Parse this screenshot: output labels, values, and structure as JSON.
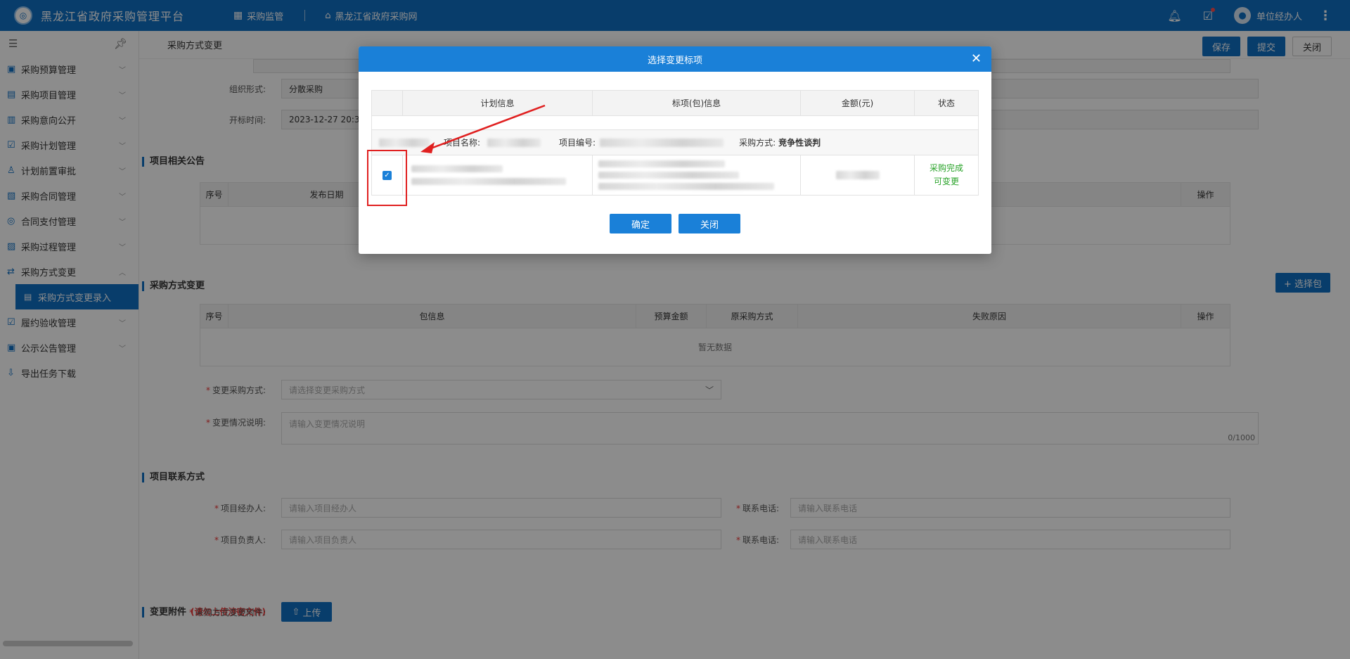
{
  "app": {
    "title": "黑龙江省政府采购管理平台",
    "logo_text": "◎",
    "nav": [
      "采购监管",
      "黑龙江省政府采购网"
    ],
    "user": "单位经办人"
  },
  "sidebar": {
    "items": [
      {
        "label": "采购预算管理"
      },
      {
        "label": "采购项目管理"
      },
      {
        "label": "采购意向公开"
      },
      {
        "label": "采购计划管理"
      },
      {
        "label": "计划前置审批"
      },
      {
        "label": "采购合同管理"
      },
      {
        "label": "合同支付管理"
      },
      {
        "label": "采购过程管理"
      },
      {
        "label": "采购方式变更"
      },
      {
        "label": "履约验收管理"
      },
      {
        "label": "公示公告管理"
      },
      {
        "label": "导出任务下载"
      }
    ],
    "active_sub": "采购方式变更录入"
  },
  "page": {
    "title": "采购方式变更",
    "buttons": {
      "save": "保存",
      "submit": "提交",
      "close": "关闭"
    },
    "org_form_label": "组织形式:",
    "org_form_value": "分散采购",
    "open_time_label": "开标时间:",
    "open_time_value": "2023-12-27 20:31:39",
    "announce_section": "项目相关公告",
    "announce_cols": [
      "序号",
      "发布日期",
      "操作"
    ],
    "change_section": "采购方式变更",
    "select_pkg_btn": "+ 选择包",
    "change_cols": [
      "序号",
      "包信息",
      "预算金额",
      "原采购方式",
      "失败原因",
      "操作"
    ],
    "no_data": "暂无数据",
    "change_method_label": "变更采购方式:",
    "change_method_placeholder": "请选择变更采购方式",
    "change_desc_label": "变更情况说明:",
    "change_desc_placeholder": "请输入变更情况说明",
    "char_count": "0/1000",
    "contact_section": "项目联系方式",
    "handler_label": "项目经办人:",
    "handler_placeholder": "请输入项目经办人",
    "phone_label": "联系电话:",
    "phone_placeholder": "请输入联系电话",
    "leader_label": "项目负责人:",
    "leader_placeholder": "请输入项目负责人",
    "attach_section": "变更附件",
    "attach_warn": "(请勿上传涉密文件)",
    "attach_label": "采购方式变更附件:",
    "upload_btn": "上传"
  },
  "modal": {
    "title": "选择变更标项",
    "cols": [
      "计划信息",
      "标项(包)信息",
      "金额(元)",
      "状态"
    ],
    "group_name_label": "项目名称:",
    "group_code_label": "项目编号:",
    "group_method_label": "采购方式:",
    "group_method_value": "竞争性谈判",
    "row_status_1": "采购完成",
    "row_status_2": "可变更",
    "confirm": "确定",
    "close": "关闭"
  }
}
